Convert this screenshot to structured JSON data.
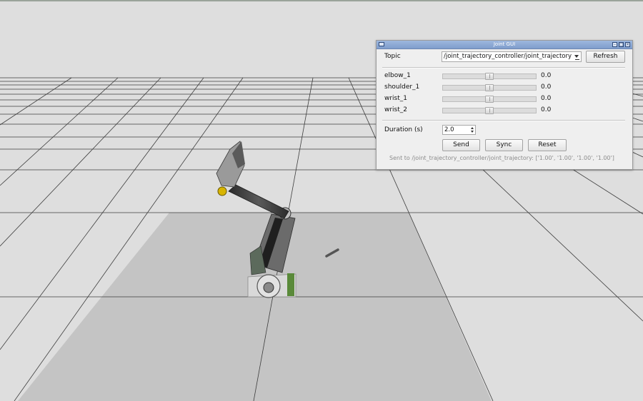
{
  "window": {
    "title": "Joint GUI",
    "controls": {
      "minimize": "–",
      "maximize": "□",
      "close": "×"
    }
  },
  "topic": {
    "label": "Topic",
    "value": "/joint_trajectory_controller/joint_trajectory",
    "refresh_label": "Refresh"
  },
  "joints": [
    {
      "name": "elbow_1",
      "value": "0.0",
      "position": 0.5
    },
    {
      "name": "shoulder_1",
      "value": "0.0",
      "position": 0.5
    },
    {
      "name": "wrist_1",
      "value": "0.0",
      "position": 0.5
    },
    {
      "name": "wrist_2",
      "value": "0.0",
      "position": 0.5
    }
  ],
  "duration": {
    "label": "Duration (s)",
    "value": "2.0"
  },
  "buttons": {
    "send": "Send",
    "sync": "Sync",
    "reset": "Reset"
  },
  "status": "Sent to /joint_trajectory_controller/joint_trajectory: ['1.00', '1.00', '1.00', '1.00']",
  "colors": {
    "background": "#dedede",
    "grid_line": "#3a3a3a",
    "ground_plane": "#c2c2c2",
    "titlebar": "#8aa7d4",
    "accent_yellow": "#d8b400"
  },
  "icons": [
    "window-menu-icon",
    "minimize-icon",
    "maximize-icon",
    "close-icon",
    "dropdown-arrow-icon",
    "spin-up-icon",
    "spin-down-icon"
  ]
}
